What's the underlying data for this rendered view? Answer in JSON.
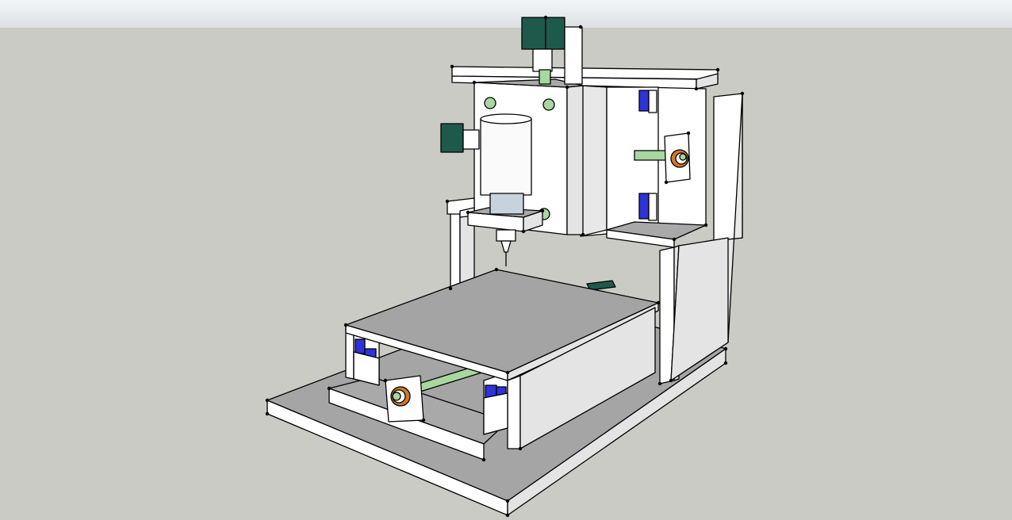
{
  "viewport": {
    "sky_color": "#eceff1",
    "ground_color": "#cbcbc6"
  },
  "model": {
    "components": [
      "base-plate",
      "y-axis-carriage",
      "work-table",
      "gantry-columns",
      "gantry-crossbeam",
      "z-axis-carriage",
      "spindle-motor",
      "milling-bit",
      "x-axis-stepper-motor",
      "z-axis-stepper-motor",
      "y-axis-stepper-motor",
      "lead-screws",
      "bearing-blocks"
    ],
    "colors": {
      "face_light": "#f2f2f2",
      "face_mid": "#e2e2e2",
      "face_dark": "#a4a4a4",
      "motor": "#1e5a4c",
      "lead_screw": "#a9d7a0",
      "bearing_block": "#2f32d8",
      "coupling": "#d4782a"
    }
  }
}
